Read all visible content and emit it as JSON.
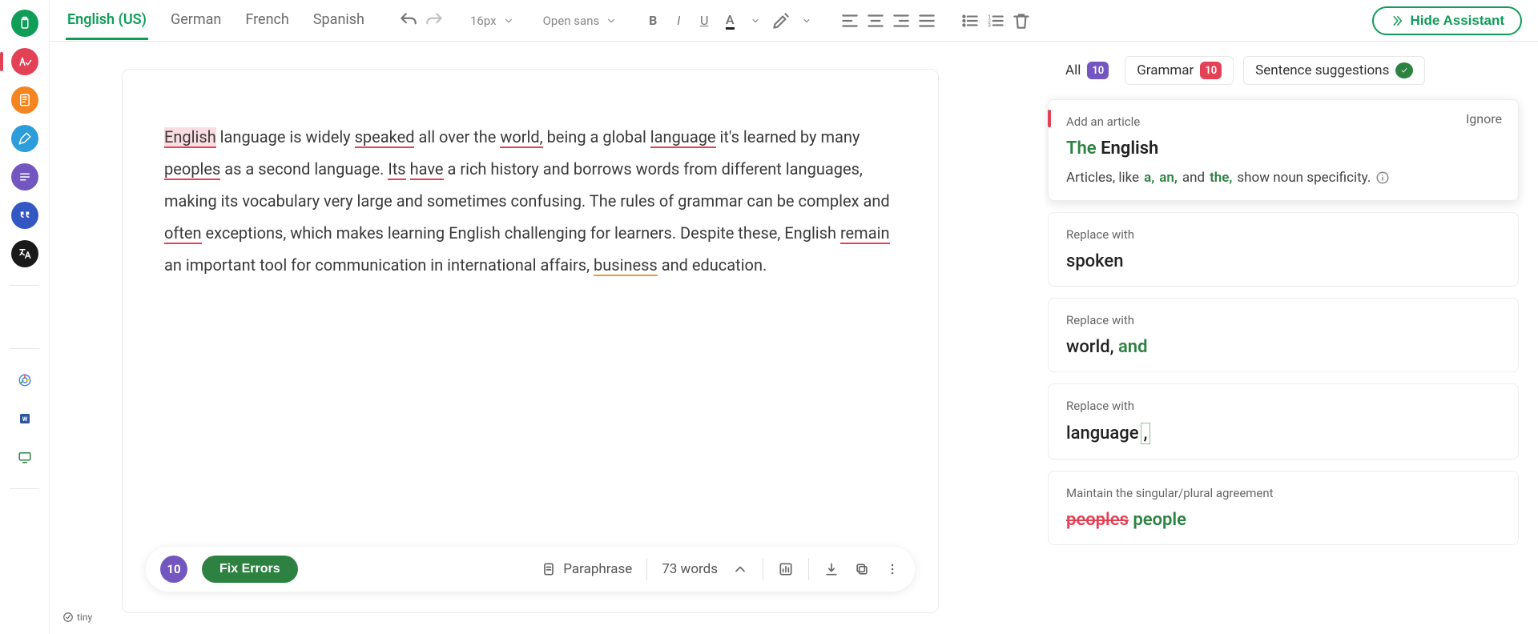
{
  "toolbar": {
    "languages": [
      "English (US)",
      "German",
      "French",
      "Spanish"
    ],
    "active_language": 0,
    "font_size": "16px",
    "font_family": "Open sans",
    "hide_assistant_label": "Hide Assistant"
  },
  "editor": {
    "segments": [
      {
        "t": "English",
        "cls": "ul-red hl"
      },
      {
        "t": " language is widely "
      },
      {
        "t": "speaked",
        "cls": "ul-red"
      },
      {
        "t": " all over the "
      },
      {
        "t": "world,",
        "cls": "ul-red"
      },
      {
        "t": " being a global "
      },
      {
        "t": "language",
        "cls": "ul-red"
      },
      {
        "t": " it's learned by many "
      },
      {
        "t": "peoples",
        "cls": "ul-red"
      },
      {
        "t": " as a second language. "
      },
      {
        "t": "Its",
        "cls": "ul-red"
      },
      {
        "t": " "
      },
      {
        "t": "have",
        "cls": "ul-red"
      },
      {
        "t": " a rich history and borrows words from different languages, making its vocabulary very large and sometimes confusing. The rules of grammar can be complex and "
      },
      {
        "t": "often",
        "cls": "ul-red"
      },
      {
        "t": " exceptions, which makes learning English challenging for learners. Despite these, English "
      },
      {
        "t": "remain",
        "cls": "ul-red"
      },
      {
        "t": " an important tool for communication in international affairs, "
      },
      {
        "t": "business",
        "cls": "ul-orange"
      },
      {
        "t": " and education."
      }
    ]
  },
  "action_bar": {
    "error_count": "10",
    "fix_label": "Fix Errors",
    "paraphrase_label": "Paraphrase",
    "word_count": "73 words"
  },
  "assistant": {
    "filters": {
      "all_label": "All",
      "all_count": "10",
      "grammar_label": "Grammar",
      "grammar_count": "10",
      "sentence_label": "Sentence suggestions"
    },
    "cards": [
      {
        "type": "article",
        "label": "Add an article",
        "ignore": "Ignore",
        "headline_prefix": "The",
        "headline_rest": " English",
        "desc_pre": "Articles, like ",
        "desc_a": "a,",
        "desc_an": " an,",
        "desc_mid": " and ",
        "desc_the": "the,",
        "desc_post": " show noun specificity."
      },
      {
        "type": "replace",
        "label": "Replace with",
        "value": "spoken"
      },
      {
        "type": "replace_rich",
        "label": "Replace with",
        "plain": "world, ",
        "green": "and"
      },
      {
        "type": "replace_cursor",
        "label": "Replace with",
        "plain": "language",
        "cursor": ","
      },
      {
        "type": "agreement",
        "label": "Maintain the singular/plural agreement",
        "strike": "peoples",
        "green": " people"
      }
    ]
  },
  "tiny_label": "tiny"
}
